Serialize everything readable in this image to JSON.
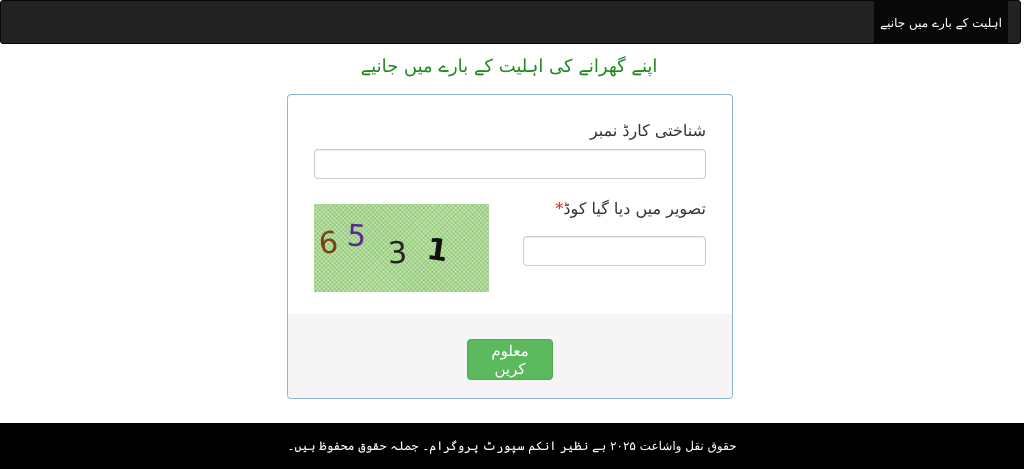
{
  "navbar": {
    "item_label": "اہلیت کے بارے میں جانیے"
  },
  "page": {
    "heading": "اپنے گھرانے کی اہلیت کے بارے میں جانیے"
  },
  "form": {
    "cnic_label": "شناختی کارڈ نمبر",
    "cnic_value": "",
    "captcha_label": "تصویر میں دیا گیا کوڈ",
    "required_mark": "*",
    "captcha_value": "",
    "captcha_digits": [
      "6",
      "5",
      "3",
      "1"
    ],
    "captcha_colors": [
      "#7a3f12",
      "#5a2a8a",
      "#222222",
      "#111111"
    ],
    "submit_label": "معلوم کریں"
  },
  "footer": {
    "text": "حقوق نقل واشاعت ۲۰۲۵ بے نظیر انکم سپورٹ پروگرام۔ جملہ حقوق محفوظ ہیں۔"
  },
  "colors": {
    "heading": "#1d8a1d",
    "button": "#5cb85c",
    "navbar": "#222222",
    "footer": "#000000"
  }
}
